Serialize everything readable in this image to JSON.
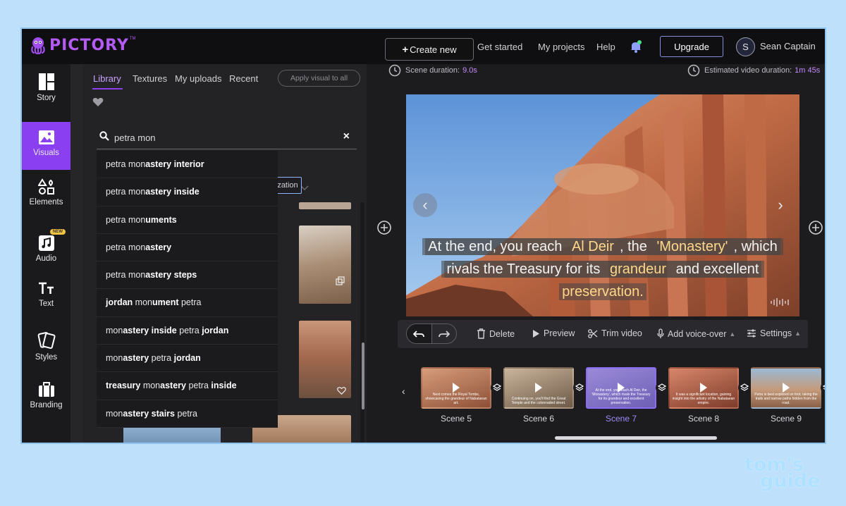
{
  "header": {
    "logo": "PICTORY",
    "logo_tm": "TM",
    "create_label": "Create new",
    "nav": [
      "Get started",
      "My projects",
      "Help"
    ],
    "upgrade_label": "Upgrade",
    "avatar_initial": "S",
    "user_name": "Sean Captain"
  },
  "sidebar": {
    "items": [
      {
        "label": "Story",
        "icon": "story-icon"
      },
      {
        "label": "Visuals",
        "icon": "image-icon",
        "active": true
      },
      {
        "label": "Elements",
        "icon": "shapes-icon"
      },
      {
        "label": "Audio",
        "icon": "music-icon",
        "badge": "NEW"
      },
      {
        "label": "Text",
        "icon": "text-icon"
      },
      {
        "label": "Styles",
        "icon": "cards-icon"
      },
      {
        "label": "Branding",
        "icon": "briefcase-icon"
      }
    ]
  },
  "library": {
    "tabs": [
      "Library",
      "Textures",
      "My uploads",
      "Recent"
    ],
    "apply_label": "Apply visual to all",
    "filter_label": "zation",
    "search": {
      "value": "petra mon",
      "placeholder": ""
    },
    "suggestions": [
      {
        "pre": "petra mon",
        "bold": "astery interior",
        "post": ""
      },
      {
        "pre": "petra mon",
        "bold": "astery inside",
        "post": ""
      },
      {
        "pre": "petra mon",
        "bold": "uments",
        "post": ""
      },
      {
        "pre": "petra mon",
        "bold": "astery",
        "post": ""
      },
      {
        "pre": "petra mon",
        "bold": "astery steps",
        "post": ""
      },
      {
        "pre": "",
        "bold": "jordan",
        "post": " mon",
        "bold2": "ument",
        "post2": " petra"
      },
      {
        "pre": "mon",
        "bold": "astery inside",
        "post": " petra ",
        "bold2": "jordan",
        "post2": ""
      },
      {
        "pre": "mon",
        "bold": "astery",
        "post": " petra ",
        "bold2": "jordan",
        "post2": ""
      },
      {
        "pre": "",
        "bold": "treasury",
        "post": " mon",
        "bold2": "astery",
        "post2": " petra ",
        "bold3": "inside"
      },
      {
        "pre": "mon",
        "bold": "astery stairs",
        "post": " petra"
      }
    ]
  },
  "editor": {
    "scene_duration_label": "Scene duration:",
    "scene_duration": "9.0s",
    "estimated_label": "Estimated video duration:",
    "estimated": "1m 45s",
    "caption": {
      "line1a": "At the end, you reach ",
      "line1b": "Al Deir",
      "line1c": ", the ",
      "line1d": "'Monastery'",
      "line1e": ", which",
      "line2a": "rivals the Treasury for its ",
      "line2b": "grandeur",
      "line2c": " and excellent",
      "line3": "preservation."
    },
    "toolbar": {
      "delete": "Delete",
      "preview": "Preview",
      "trim": "Trim video",
      "voiceover": "Add voice-over",
      "settings": "Settings"
    },
    "scenes": [
      {
        "label": "Scene 5",
        "mini": "Next comes the Royal Tombs, showcasing the grandeur of Nabataean art."
      },
      {
        "label": "Scene 6",
        "mini": "Continuing on, you'll find the Great Temple and the colonnaded street."
      },
      {
        "label": "Scene 7",
        "mini": "At the end, you reach Al Deir, the 'Monastery', which rivals the Treasury for its grandeur and excellent preservation.",
        "active": true
      },
      {
        "label": "Scene 8",
        "mini": "It was a significant location, gaining insight into the artistry of the Nabataean empire."
      },
      {
        "label": "Scene 9",
        "mini": "Petra is best explored on foot, taking the trails and narrow paths hidden from the road."
      }
    ]
  },
  "watermark": {
    "line1": "tom's",
    "line2": "guide"
  },
  "colors": {
    "accent": "#8a3ff0",
    "highlight": "#c48af8",
    "caption_highlight": "#ffd88a"
  }
}
